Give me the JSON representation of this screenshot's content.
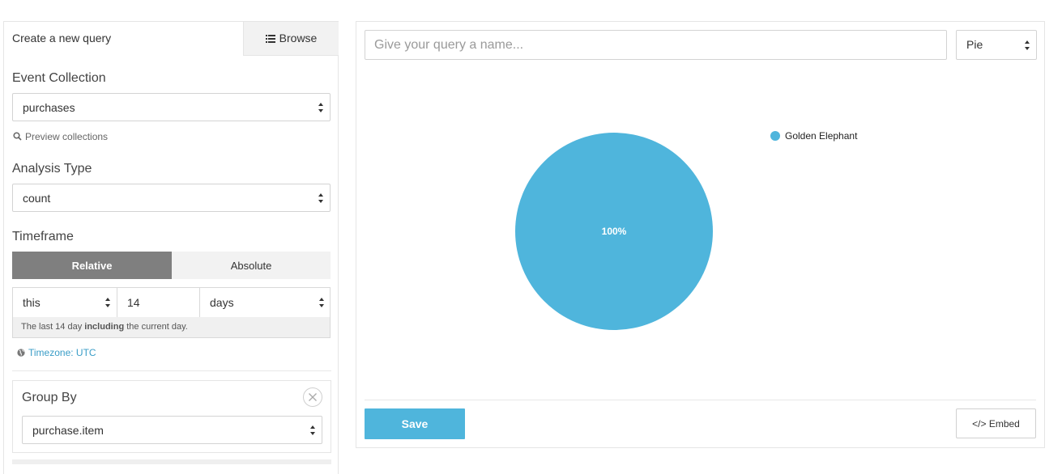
{
  "left": {
    "tab_create": "Create a new query",
    "tab_browse": "Browse",
    "event_collection": {
      "label": "Event Collection",
      "value": "purchases",
      "preview_link": "Preview collections"
    },
    "analysis_type": {
      "label": "Analysis Type",
      "value": "count"
    },
    "timeframe": {
      "label": "Timeframe",
      "relative": "Relative",
      "absolute": "Absolute",
      "selected": "Relative",
      "this": "this",
      "amount": "14",
      "unit": "days",
      "note_prefix": "The last 14 day",
      "note_bold": "including",
      "note_suffix": "the current day.",
      "timezone": "Timezone: UTC"
    },
    "group_by": {
      "label": "Group By",
      "value": "purchase.item"
    }
  },
  "right": {
    "query_name_placeholder": "Give your query a name...",
    "query_name_value": "",
    "chart_type": "Pie",
    "save_label": "Save",
    "embed_label": "</> Embed"
  },
  "chart_data": {
    "type": "pie",
    "slices": [
      {
        "name": "Golden Elephant",
        "percent": 100,
        "label": "100%",
        "color": "#4fb5dc"
      }
    ],
    "legend": "right"
  },
  "colors": {
    "accent": "#4fb5dc",
    "link": "#3a9dc7",
    "toggle_active": "#7f7f7f"
  }
}
